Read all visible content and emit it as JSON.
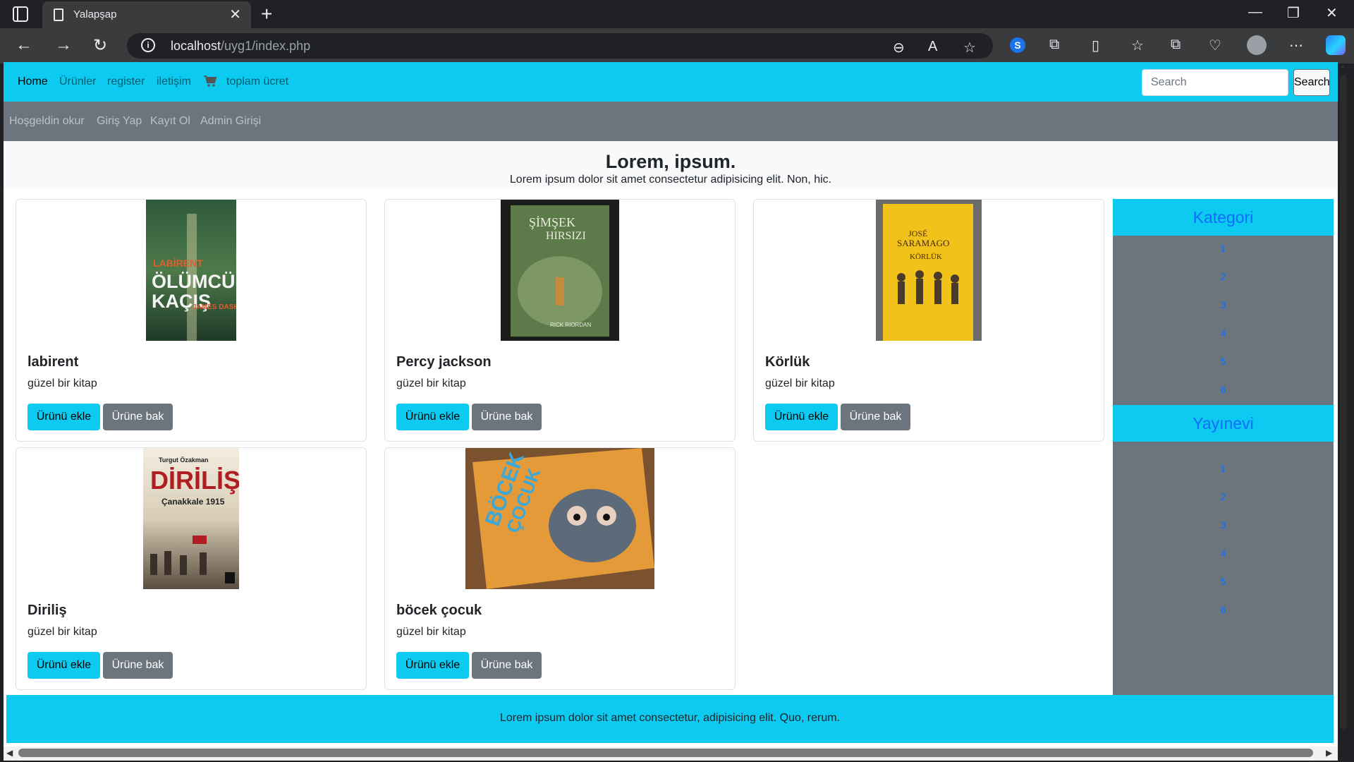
{
  "browser": {
    "tab_title": "Yalapşap",
    "url_host": "localhost",
    "url_path": "/uyg1/index.php"
  },
  "topnav": {
    "home": "Home",
    "products": "Ürünler",
    "register": "register",
    "contact": "iletişim",
    "total": "toplam ücret",
    "search_placeholder": "Search",
    "search_button": "Search"
  },
  "subnav": {
    "welcome": "Hoşgeldin okur",
    "login": "Giriş Yap",
    "signup": "Kayıt Ol",
    "admin": "Admin Girişi"
  },
  "hero": {
    "title": "Lorem, ipsum.",
    "text": "Lorem ipsum dolor sit amet consectetur adipisicing elit. Non, hic."
  },
  "products": [
    {
      "name": "labirent",
      "desc": "güzel bir kitap",
      "add": "Ürünü ekle",
      "view": "Ürüne bak",
      "cover_text": [
        "LABİRENT",
        "ÖLÜMCÜL",
        "KAÇIŞ",
        "JAMES DASHNER"
      ]
    },
    {
      "name": "Percy jackson",
      "desc": "güzel bir kitap",
      "add": "Ürünü ekle",
      "view": "Ürüne bak",
      "cover_text": [
        "ŞİMŞEK",
        "HIRSIZI",
        "RICK RIORDAN"
      ]
    },
    {
      "name": "Körlük",
      "desc": "güzel bir kitap",
      "add": "Ürünü ekle",
      "view": "Ürüne bak",
      "cover_text": [
        "JOSÉ",
        "SARAMAGO",
        "KÖRLÜK"
      ]
    },
    {
      "name": "Diriliş",
      "desc": "güzel bir kitap",
      "add": "Ürünü ekle",
      "view": "Ürüne bak",
      "cover_text": [
        "Turgut Özakman",
        "DİRİLİŞ",
        "Çanakkale 1915"
      ]
    },
    {
      "name": "böcek çocuk",
      "desc": "güzel bir kitap",
      "add": "Ürünü ekle",
      "view": "Ürüne bak",
      "cover_text": [
        "BÖCEK",
        "ÇOCUK"
      ]
    }
  ],
  "sidebar": {
    "category_title": "Kategori",
    "categories": [
      "1",
      "2",
      "3",
      "4",
      "5",
      "6"
    ],
    "publisher_title": "Yayınevi",
    "publishers": [
      "1",
      "2",
      "3",
      "4",
      "5",
      "6"
    ]
  },
  "footer": {
    "text": "Lorem ipsum dolor sit amet consectetur, adipisicing elit. Quo, rerum."
  }
}
